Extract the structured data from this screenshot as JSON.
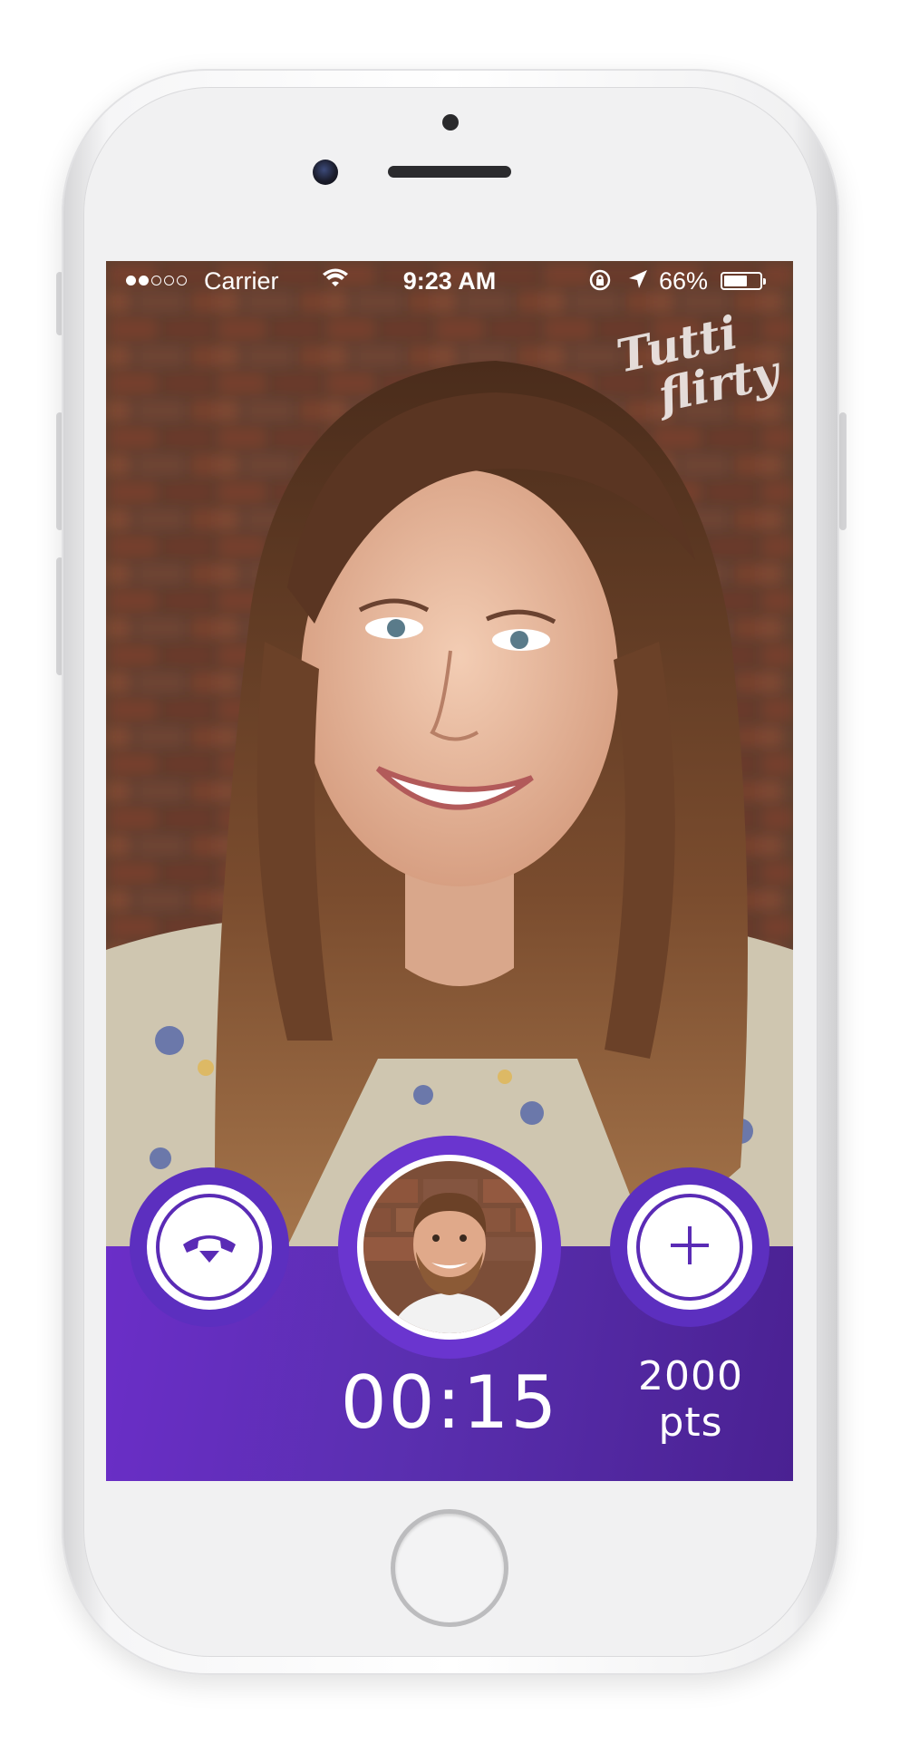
{
  "status_bar": {
    "signal": "●●○○○",
    "carrier": "Carrier",
    "time": "9:23 AM",
    "battery_percent": "66%",
    "battery_level": 0.66,
    "icons": [
      "wifi-icon",
      "rotation-lock-icon",
      "location-arrow-icon",
      "battery-icon"
    ]
  },
  "app": {
    "logo_line1": "Tutti",
    "logo_line2": "flirty"
  },
  "call": {
    "timer": "00:15",
    "points": "2000 pts",
    "end_call_icon": "hang-up-phone-icon",
    "add_icon": "plus-icon",
    "remote_video": "video of smiling woman in front of brick wall",
    "self_view": "thumbnail of smiling bearded man"
  },
  "colors": {
    "accent": "#5a2bb5",
    "panel_start": "#6b2ec8",
    "panel_end": "#4a2192",
    "text": "#ffffff"
  }
}
